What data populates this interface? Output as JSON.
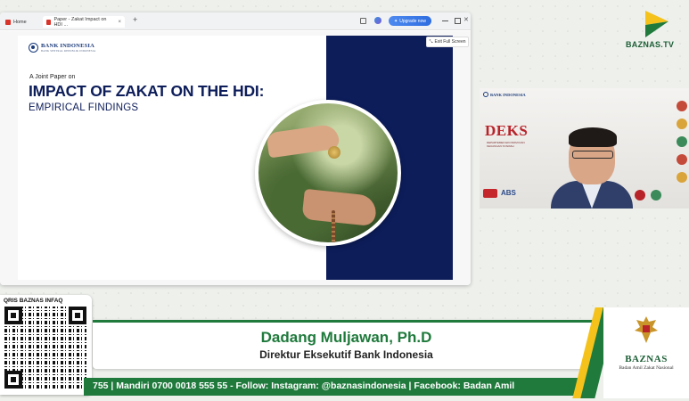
{
  "browser": {
    "tabs": [
      {
        "label": "Home",
        "icon": "vivaldi-icon"
      },
      {
        "label": "Paper - Zakat Impact on HDI ...",
        "icon": "pdf-icon"
      }
    ],
    "new_tab_label": "+",
    "upgrade_label": "Upgrade now",
    "exit_fullscreen_label": "Exit Full Screen"
  },
  "slide": {
    "logo_text": "BANK INDONESIA",
    "logo_sub": "BANK SENTRAL REPUBLIK INDONESIA",
    "kicker": "A Joint Paper on",
    "title": "IMPACT OF ZAKAT ON THE HDI:",
    "subtitle": "EMPIRICAL FINDINGS",
    "navy_color": "#0d1d5a"
  },
  "brand": {
    "channel": "BAZNAS.TV"
  },
  "video": {
    "bi_label": "BANK INDONESIA",
    "deks": "DEKS",
    "deks_sub": "DEPARTEMEN EKONOMI DAN KEUANGAN SYARIAH",
    "abs": "ABS"
  },
  "qr": {
    "title": "QRIS BAZNAS INFAQ"
  },
  "speaker": {
    "name": "Dadang Muljawan, Ph.D",
    "role": "Direktur Eksekutif Bank Indonesia"
  },
  "ticker": {
    "text": "755 | Mandiri 0700 0018 555 55 - Follow: Instagram: @baznasindonesia | Facebook: Badan Amil"
  },
  "org": {
    "name": "BAZNAS",
    "full_name": "Badan Amil Zakat Nasional",
    "green": "#1f7a3c",
    "yellow": "#f4c21b"
  }
}
